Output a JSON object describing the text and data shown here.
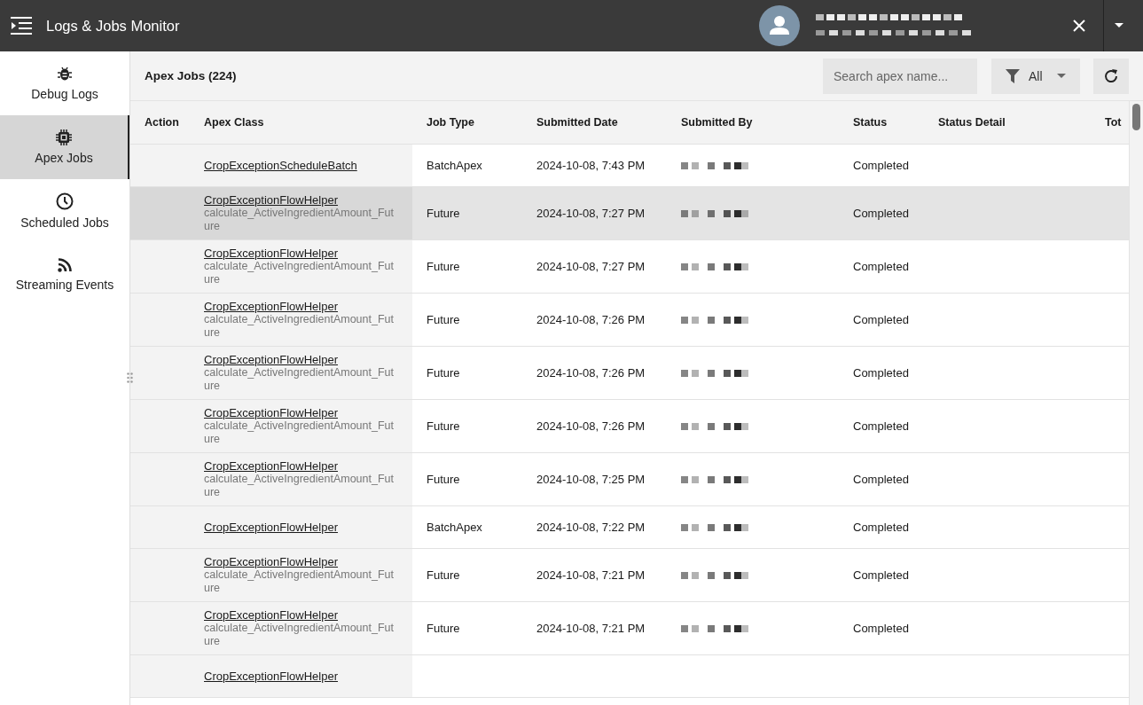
{
  "app": {
    "title": "Logs & Jobs Monitor"
  },
  "sidebar": {
    "items": [
      {
        "label": "Debug Logs",
        "kind": "bug",
        "selected": false
      },
      {
        "label": "Apex Jobs",
        "kind": "chip",
        "selected": true
      },
      {
        "label": "Scheduled Jobs",
        "kind": "clock",
        "selected": false
      },
      {
        "label": "Streaming Events",
        "kind": "feed",
        "selected": false
      }
    ]
  },
  "toolbar": {
    "title": "Apex Jobs (224)",
    "search": {
      "placeholder": "Search apex name..."
    },
    "filter": {
      "value": "All"
    }
  },
  "table": {
    "columns": [
      "Action",
      "Apex Class",
      "Job Type",
      "Submitted Date",
      "Submitted By",
      "Status",
      "Status Detail",
      "Tot"
    ],
    "rows": [
      {
        "apex_class": "CropExceptionScheduleBatch",
        "job_type": "BatchApex",
        "submitted_date": "2024-10-08, 7:43 PM",
        "status": "Completed",
        "selected": false
      },
      {
        "apex_class": "CropExceptionFlowHelper",
        "method": "calculate_ActiveIngredientAmount_Future",
        "job_type": "Future",
        "submitted_date": "2024-10-08, 7:27 PM",
        "status": "Completed",
        "selected": true
      },
      {
        "apex_class": "CropExceptionFlowHelper",
        "method": "calculate_ActiveIngredientAmount_Future",
        "job_type": "Future",
        "submitted_date": "2024-10-08, 7:27 PM",
        "status": "Completed",
        "selected": false
      },
      {
        "apex_class": "CropExceptionFlowHelper",
        "method": "calculate_ActiveIngredientAmount_Future",
        "job_type": "Future",
        "submitted_date": "2024-10-08, 7:26 PM",
        "status": "Completed",
        "selected": false
      },
      {
        "apex_class": "CropExceptionFlowHelper",
        "method": "calculate_ActiveIngredientAmount_Future",
        "job_type": "Future",
        "submitted_date": "2024-10-08, 7:26 PM",
        "status": "Completed",
        "selected": false
      },
      {
        "apex_class": "CropExceptionFlowHelper",
        "method": "calculate_ActiveIngredientAmount_Future",
        "job_type": "Future",
        "submitted_date": "2024-10-08, 7:26 PM",
        "status": "Completed",
        "selected": false
      },
      {
        "apex_class": "CropExceptionFlowHelper",
        "method": "calculate_ActiveIngredientAmount_Future",
        "job_type": "Future",
        "submitted_date": "2024-10-08, 7:25 PM",
        "status": "Completed",
        "selected": false
      },
      {
        "apex_class": "CropExceptionFlowHelper",
        "job_type": "BatchApex",
        "submitted_date": "2024-10-08, 7:22 PM",
        "status": "Completed",
        "selected": false
      },
      {
        "apex_class": "CropExceptionFlowHelper",
        "method": "calculate_ActiveIngredientAmount_Future",
        "job_type": "Future",
        "submitted_date": "2024-10-08, 7:21 PM",
        "status": "Completed",
        "selected": false
      },
      {
        "apex_class": "CropExceptionFlowHelper",
        "method": "calculate_ActiveIngredientAmount_Future",
        "job_type": "Future",
        "submitted_date": "2024-10-08, 7:21 PM",
        "status": "Completed",
        "selected": false
      },
      {
        "apex_class": "CropExceptionFlowHelper",
        "selected": false
      }
    ]
  }
}
